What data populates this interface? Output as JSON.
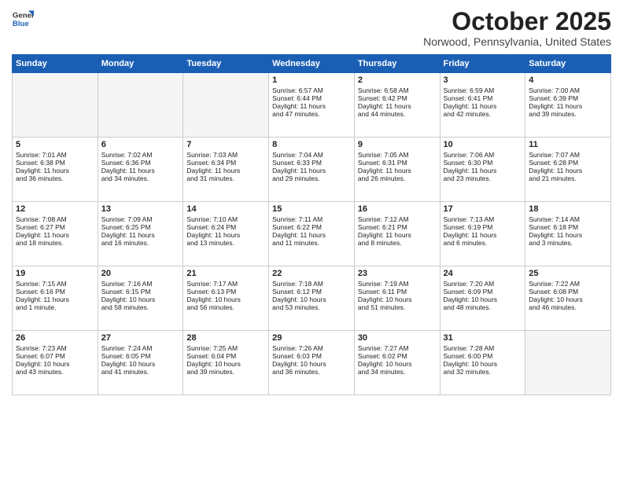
{
  "header": {
    "logo_line1": "General",
    "logo_line2": "Blue",
    "month": "October 2025",
    "location": "Norwood, Pennsylvania, United States"
  },
  "days_of_week": [
    "Sunday",
    "Monday",
    "Tuesday",
    "Wednesday",
    "Thursday",
    "Friday",
    "Saturday"
  ],
  "weeks": [
    [
      {
        "day": "",
        "info": ""
      },
      {
        "day": "",
        "info": ""
      },
      {
        "day": "",
        "info": ""
      },
      {
        "day": "1",
        "info": "Sunrise: 6:57 AM\nSunset: 6:44 PM\nDaylight: 11 hours\nand 47 minutes."
      },
      {
        "day": "2",
        "info": "Sunrise: 6:58 AM\nSunset: 6:42 PM\nDaylight: 11 hours\nand 44 minutes."
      },
      {
        "day": "3",
        "info": "Sunrise: 6:59 AM\nSunset: 6:41 PM\nDaylight: 11 hours\nand 42 minutes."
      },
      {
        "day": "4",
        "info": "Sunrise: 7:00 AM\nSunset: 6:39 PM\nDaylight: 11 hours\nand 39 minutes."
      }
    ],
    [
      {
        "day": "5",
        "info": "Sunrise: 7:01 AM\nSunset: 6:38 PM\nDaylight: 11 hours\nand 36 minutes."
      },
      {
        "day": "6",
        "info": "Sunrise: 7:02 AM\nSunset: 6:36 PM\nDaylight: 11 hours\nand 34 minutes."
      },
      {
        "day": "7",
        "info": "Sunrise: 7:03 AM\nSunset: 6:34 PM\nDaylight: 11 hours\nand 31 minutes."
      },
      {
        "day": "8",
        "info": "Sunrise: 7:04 AM\nSunset: 6:33 PM\nDaylight: 11 hours\nand 29 minutes."
      },
      {
        "day": "9",
        "info": "Sunrise: 7:05 AM\nSunset: 6:31 PM\nDaylight: 11 hours\nand 26 minutes."
      },
      {
        "day": "10",
        "info": "Sunrise: 7:06 AM\nSunset: 6:30 PM\nDaylight: 11 hours\nand 23 minutes."
      },
      {
        "day": "11",
        "info": "Sunrise: 7:07 AM\nSunset: 6:28 PM\nDaylight: 11 hours\nand 21 minutes."
      }
    ],
    [
      {
        "day": "12",
        "info": "Sunrise: 7:08 AM\nSunset: 6:27 PM\nDaylight: 11 hours\nand 18 minutes."
      },
      {
        "day": "13",
        "info": "Sunrise: 7:09 AM\nSunset: 6:25 PM\nDaylight: 11 hours\nand 16 minutes."
      },
      {
        "day": "14",
        "info": "Sunrise: 7:10 AM\nSunset: 6:24 PM\nDaylight: 11 hours\nand 13 minutes."
      },
      {
        "day": "15",
        "info": "Sunrise: 7:11 AM\nSunset: 6:22 PM\nDaylight: 11 hours\nand 11 minutes."
      },
      {
        "day": "16",
        "info": "Sunrise: 7:12 AM\nSunset: 6:21 PM\nDaylight: 11 hours\nand 8 minutes."
      },
      {
        "day": "17",
        "info": "Sunrise: 7:13 AM\nSunset: 6:19 PM\nDaylight: 11 hours\nand 6 minutes."
      },
      {
        "day": "18",
        "info": "Sunrise: 7:14 AM\nSunset: 6:18 PM\nDaylight: 11 hours\nand 3 minutes."
      }
    ],
    [
      {
        "day": "19",
        "info": "Sunrise: 7:15 AM\nSunset: 6:16 PM\nDaylight: 11 hours\nand 1 minute."
      },
      {
        "day": "20",
        "info": "Sunrise: 7:16 AM\nSunset: 6:15 PM\nDaylight: 10 hours\nand 58 minutes."
      },
      {
        "day": "21",
        "info": "Sunrise: 7:17 AM\nSunset: 6:13 PM\nDaylight: 10 hours\nand 56 minutes."
      },
      {
        "day": "22",
        "info": "Sunrise: 7:18 AM\nSunset: 6:12 PM\nDaylight: 10 hours\nand 53 minutes."
      },
      {
        "day": "23",
        "info": "Sunrise: 7:19 AM\nSunset: 6:11 PM\nDaylight: 10 hours\nand 51 minutes."
      },
      {
        "day": "24",
        "info": "Sunrise: 7:20 AM\nSunset: 6:09 PM\nDaylight: 10 hours\nand 48 minutes."
      },
      {
        "day": "25",
        "info": "Sunrise: 7:22 AM\nSunset: 6:08 PM\nDaylight: 10 hours\nand 46 minutes."
      }
    ],
    [
      {
        "day": "26",
        "info": "Sunrise: 7:23 AM\nSunset: 6:07 PM\nDaylight: 10 hours\nand 43 minutes."
      },
      {
        "day": "27",
        "info": "Sunrise: 7:24 AM\nSunset: 6:05 PM\nDaylight: 10 hours\nand 41 minutes."
      },
      {
        "day": "28",
        "info": "Sunrise: 7:25 AM\nSunset: 6:04 PM\nDaylight: 10 hours\nand 39 minutes."
      },
      {
        "day": "29",
        "info": "Sunrise: 7:26 AM\nSunset: 6:03 PM\nDaylight: 10 hours\nand 36 minutes."
      },
      {
        "day": "30",
        "info": "Sunrise: 7:27 AM\nSunset: 6:02 PM\nDaylight: 10 hours\nand 34 minutes."
      },
      {
        "day": "31",
        "info": "Sunrise: 7:28 AM\nSunset: 6:00 PM\nDaylight: 10 hours\nand 32 minutes."
      },
      {
        "day": "",
        "info": ""
      }
    ]
  ]
}
